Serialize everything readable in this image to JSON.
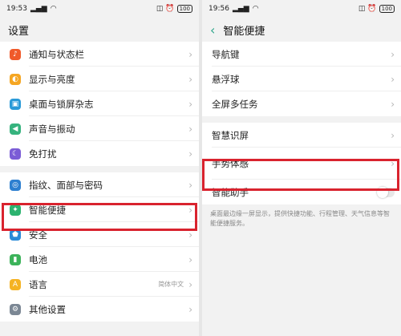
{
  "left": {
    "status": {
      "time": "19:53",
      "battery": "100"
    },
    "title": "设置",
    "groups": [
      [
        {
          "label": "通知与状态栏",
          "icon": "bell-icon",
          "color": "#f05a2a"
        },
        {
          "label": "显示与亮度",
          "icon": "brightness-icon",
          "color": "#f5a623"
        },
        {
          "label": "桌面与锁屏杂志",
          "icon": "wallpaper-icon",
          "color": "#2a9ad8"
        },
        {
          "label": "声音与振动",
          "icon": "speaker-icon",
          "color": "#36b37e"
        },
        {
          "label": "免打扰",
          "icon": "moon-icon",
          "color": "#7b5cd6"
        }
      ],
      [
        {
          "label": "指纹、面部与密码",
          "icon": "fingerprint-icon",
          "color": "#2d7fd0"
        },
        {
          "label": "智能便捷",
          "icon": "smart-icon",
          "color": "#2cb36f"
        },
        {
          "label": "安全",
          "icon": "shield-icon",
          "color": "#2a8ad8"
        },
        {
          "label": "电池",
          "icon": "battery-icon",
          "color": "#3cb35a"
        },
        {
          "label": "语言",
          "icon": "language-icon",
          "color": "#f5b323",
          "hint": "简体中文"
        },
        {
          "label": "其他设置",
          "icon": "gear-icon",
          "color": "#7b8794"
        }
      ]
    ]
  },
  "right": {
    "status": {
      "time": "19:56",
      "battery": "100"
    },
    "title": "智能便捷",
    "group1": [
      {
        "label": "导航键"
      },
      {
        "label": "悬浮球"
      },
      {
        "label": "全屏多任务"
      }
    ],
    "group2": [
      {
        "label": "智慧识屏"
      },
      {
        "label": "手势体感"
      },
      {
        "label": "智能助手"
      }
    ],
    "description": "桌面最边缘一屏显示，提供快捷功能、行程管理、天气信息等智能便捷服务。"
  },
  "colors": {
    "accent": "#2ca58a",
    "highlight": "#d9232e"
  }
}
